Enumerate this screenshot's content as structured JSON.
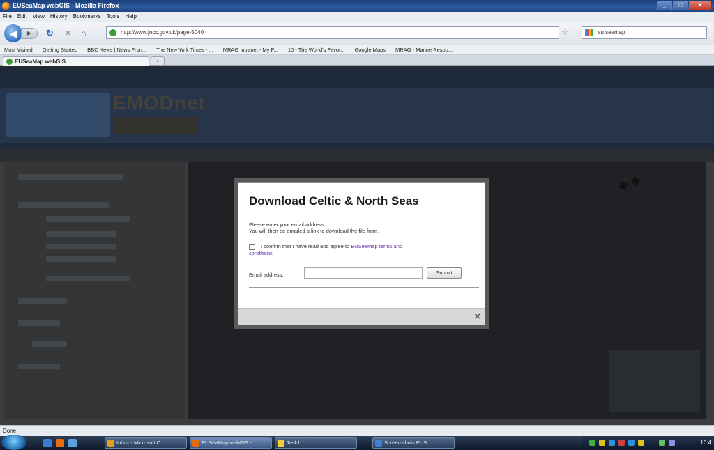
{
  "window": {
    "title": "EUSeaMap webGIS - Mozilla Firefox"
  },
  "menu": [
    "File",
    "Edit",
    "View",
    "History",
    "Bookmarks",
    "Tools",
    "Help"
  ],
  "navigation": {
    "url": "http://www.jncc.gov.uk/page-5040",
    "search_text": "eu seamap"
  },
  "bookmarks": [
    "Most Visited",
    "Getting Started",
    "BBC News | News Fron...",
    "The New York Times - ...",
    "MRAG Intranet - My P...",
    "10 - The World's Favor...",
    "Google Maps",
    "MRAG - Marine Resou..."
  ],
  "tab": {
    "label": "EUSeaMap webGIS",
    "new_tab": "+"
  },
  "page": {
    "logo_text": "EMODnet"
  },
  "modal": {
    "title": "Download Celtic & North Seas",
    "intro_line1": "Please enter your email address.",
    "intro_line2": "You will then be emailed a link to download the file from.",
    "confirm_text": "I confirm that I have read and agree to",
    "terms_link": "EUSeaMap terms and",
    "terms_link2": "conditions",
    "email_label": "Email address:",
    "email_value": "",
    "submit_label": "Submit",
    "close_label": "×"
  },
  "status": {
    "text": "Done"
  },
  "taskbar": {
    "buttons": [
      "Inbox - Microsoft O...",
      "EUSeaMap webGIS - ...",
      "Task1",
      "Screen shots EUS..."
    ],
    "clock": "16:4"
  }
}
